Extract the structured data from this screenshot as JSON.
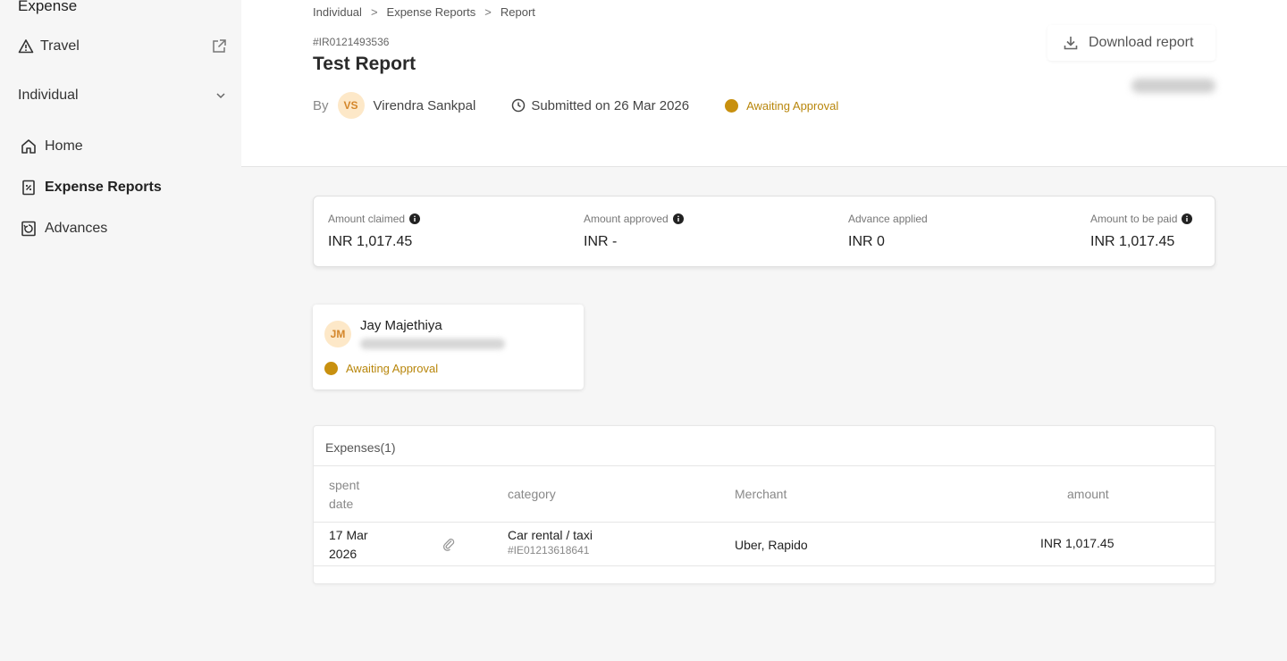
{
  "sidebar": {
    "brand": "Expense",
    "travel_label": "Travel",
    "scope_label": "Individual",
    "items": [
      {
        "label": "Home"
      },
      {
        "label": "Expense Reports"
      },
      {
        "label": "Advances"
      }
    ]
  },
  "breadcrumb": [
    "Individual",
    "Expense Reports",
    "Report"
  ],
  "breadcrumb_sep": ">",
  "report": {
    "id": "#IR0121493536",
    "title": "Test Report",
    "by_label": "By",
    "submitter_initials": "VS",
    "submitter_name": "Virendra Sankpal",
    "submitted": "Submitted on 26 Mar 2026",
    "status": "Awaiting Approval",
    "download_label": "Download report"
  },
  "summary": [
    {
      "label": "Amount claimed",
      "value": "INR 1,017.45"
    },
    {
      "label": "Amount approved",
      "value": "INR -"
    },
    {
      "label": "Advance applied",
      "value": "INR 0"
    },
    {
      "label": "Amount to be paid",
      "value": "INR 1,017.45"
    }
  ],
  "approver": {
    "initials": "JM",
    "name": "Jay Majethiya",
    "status": "Awaiting Approval"
  },
  "expenses": {
    "title": "Expenses(1)",
    "columns": {
      "spent_date_1": "spent",
      "spent_date_2": "date",
      "category": "category",
      "merchant": "Merchant",
      "amount": "amount"
    },
    "rows": [
      {
        "date_1": "17 Mar",
        "date_2": "2026",
        "category": "Car rental / taxi",
        "expense_id": "#IE01213618641",
        "merchant": "Uber, Rapido",
        "amount": "INR 1,017.45"
      }
    ]
  },
  "colors": {
    "status": "#c8900f",
    "avatar_bg": "#fde8c8",
    "avatar_text": "#d4862a"
  }
}
